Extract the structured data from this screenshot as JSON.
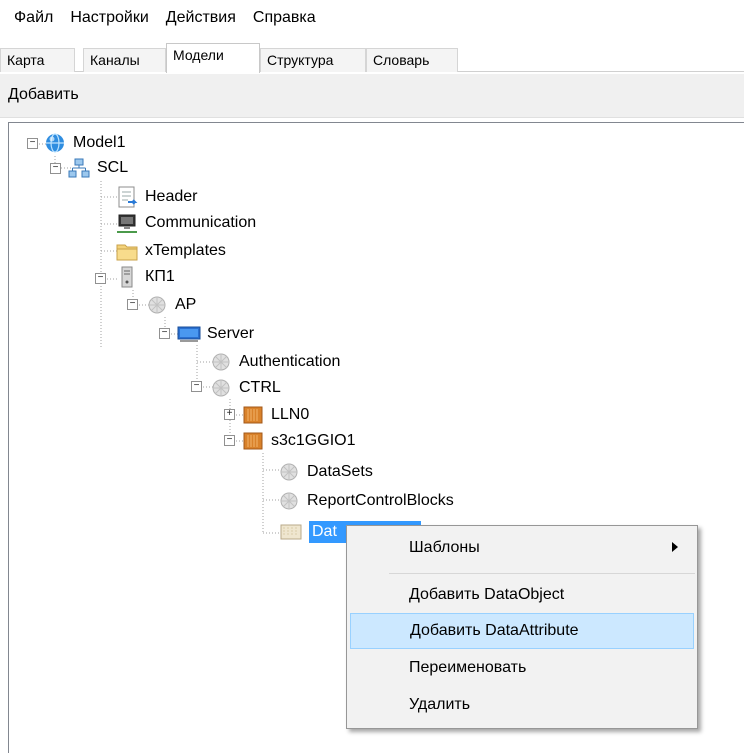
{
  "menubar": {
    "items": [
      "Файл",
      "Настройки",
      "Действия",
      "Справка"
    ]
  },
  "tabs": [
    {
      "label": "Карта",
      "active": false
    },
    {
      "label": "Каналы",
      "active": false
    },
    {
      "label": "Модели",
      "active": true
    },
    {
      "label": "Структура",
      "active": false
    },
    {
      "label": "Словарь",
      "active": false
    }
  ],
  "toolbar": {
    "add_label": "Добавить"
  },
  "tree": {
    "nodes": [
      {
        "label": "Model1",
        "icon": "globe-icon",
        "expanded": true
      },
      {
        "label": "SCL",
        "icon": "network-icon",
        "expanded": true
      },
      {
        "label": "Header",
        "icon": "document-icon"
      },
      {
        "label": "Communication",
        "icon": "computer-icon"
      },
      {
        "label": "xTemplates",
        "icon": "folder-icon"
      },
      {
        "label": "КП1",
        "icon": "server-icon",
        "expanded": true
      },
      {
        "label": "AP",
        "icon": "component-icon",
        "expanded": true
      },
      {
        "label": "Server",
        "icon": "monitor-icon",
        "expanded": true
      },
      {
        "label": "Authentication",
        "icon": "component-icon"
      },
      {
        "label": "CTRL",
        "icon": "component-icon",
        "expanded": true
      },
      {
        "label": "LLN0",
        "icon": "logical-node-icon",
        "expanded": false
      },
      {
        "label": "s3c1GGIO1",
        "icon": "logical-node-icon",
        "expanded": true
      },
      {
        "label": "DataSets",
        "icon": "component-icon"
      },
      {
        "label": "ReportControlBlocks",
        "icon": "component-icon"
      },
      {
        "label": "Dat",
        "icon": "data-object-icon",
        "selected": true
      }
    ]
  },
  "context_menu": {
    "items": [
      {
        "label": "Шаблоны",
        "submenu": true
      },
      {
        "label": "Добавить DataObject"
      },
      {
        "label": "Добавить DataAttribute",
        "highlighted": true
      },
      {
        "label": "Переименовать"
      },
      {
        "label": "Удалить"
      }
    ]
  },
  "colors": {
    "selection": "#3399ff",
    "menu_highlight": "#cce8ff",
    "toolbar_bg": "#f0f0f0"
  }
}
